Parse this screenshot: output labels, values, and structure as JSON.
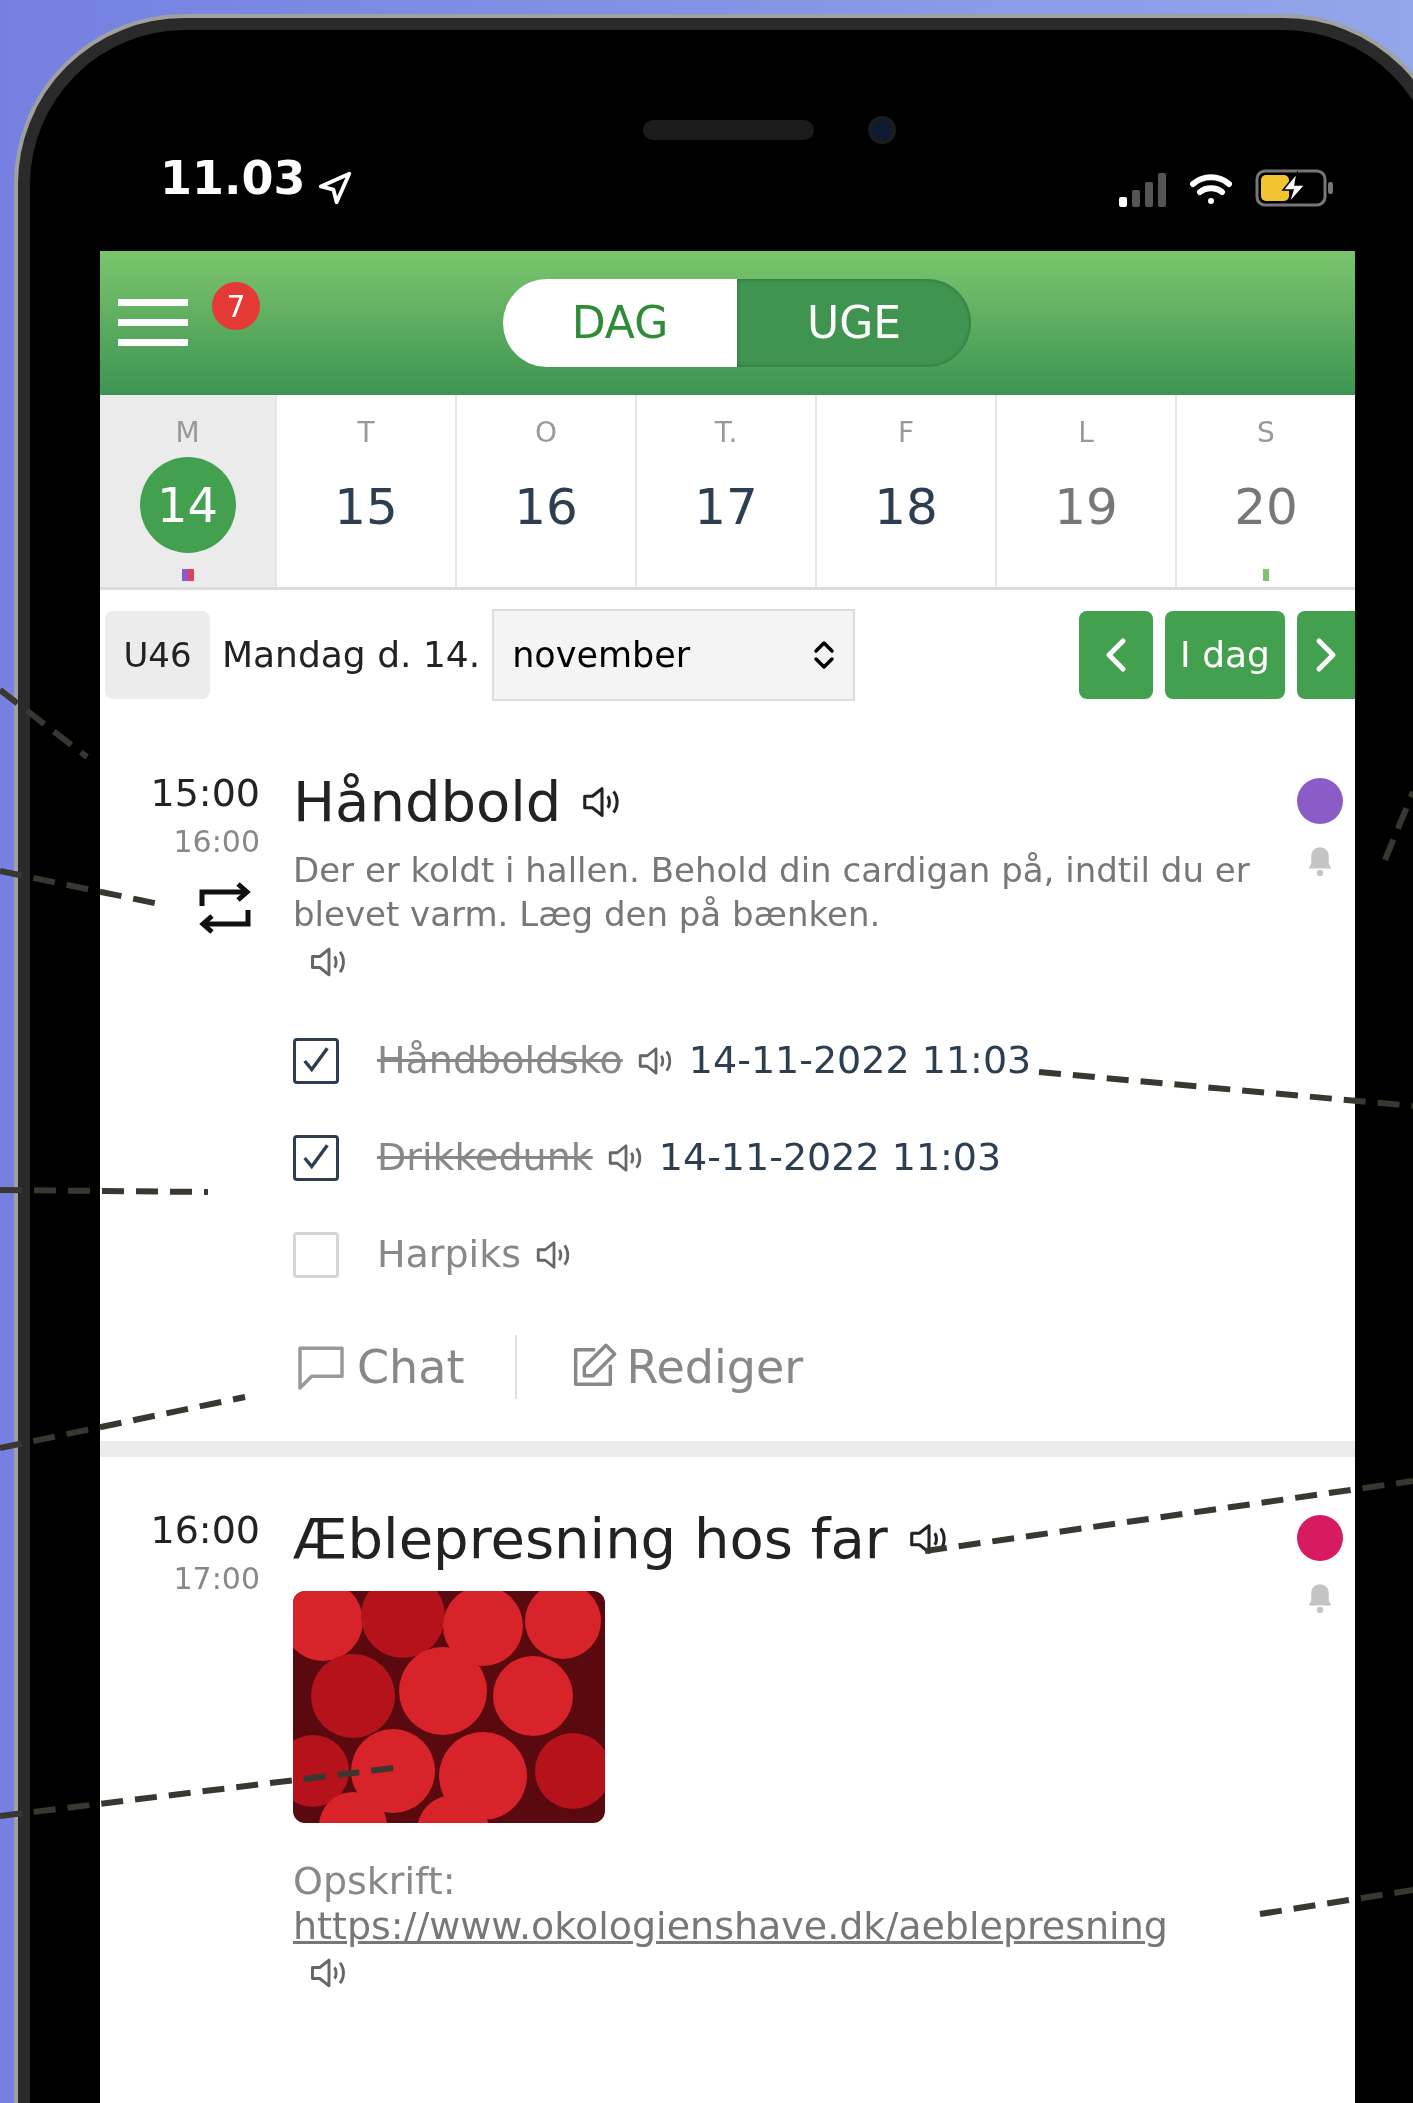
{
  "status_bar": {
    "time": "11.03"
  },
  "header": {
    "badge": "7",
    "views": [
      {
        "label": "DAG",
        "selected": true
      },
      {
        "label": "UGE",
        "selected": false
      }
    ]
  },
  "week": [
    {
      "day": "M",
      "date": "14",
      "selected": true,
      "weekend": false,
      "markers": [
        {
          "color": "#8a5cc7"
        },
        {
          "color": "#e0405a"
        }
      ]
    },
    {
      "day": "T",
      "date": "15",
      "selected": false,
      "weekend": false
    },
    {
      "day": "O",
      "date": "16",
      "selected": false,
      "weekend": false
    },
    {
      "day": "T.",
      "date": "17",
      "selected": false,
      "weekend": false
    },
    {
      "day": "F",
      "date": "18",
      "selected": false,
      "weekend": false
    },
    {
      "day": "L",
      "date": "19",
      "selected": false,
      "weekend": true
    },
    {
      "day": "S",
      "date": "20",
      "selected": false,
      "weekend": true,
      "markers": [
        {
          "color": "#7cc56e"
        }
      ]
    }
  ],
  "date_bar": {
    "week": "U46",
    "date": "Mandag d. 14.",
    "month": "november",
    "today_button": "I dag"
  },
  "events": [
    {
      "start": "15:00",
      "end": "16:00",
      "repeat": true,
      "title": "Håndbold",
      "color": "#8a5cc7",
      "description": "Der er koldt i hallen. Behold din cardigan på, indtil du er blevet varm. Læg den på bænken.",
      "checklist": [
        {
          "label": "Håndboldsko",
          "checked": true,
          "timestamp": "14-11-2022 11:03"
        },
        {
          "label": "Drikkedunk",
          "checked": true,
          "timestamp": "14-11-2022 11:03"
        },
        {
          "label": "Harpiks",
          "checked": false
        }
      ],
      "actions": [
        {
          "kind": "chat",
          "label": "Chat"
        },
        {
          "kind": "edit",
          "label": "Rediger"
        }
      ]
    },
    {
      "start": "16:00",
      "end": "17:00",
      "repeat": false,
      "title": "Æblepresning hos far",
      "color": "#d81b60",
      "note": "Opskrift:",
      "link": "https://www.okologienshave.dk/aeblepresning"
    }
  ]
}
